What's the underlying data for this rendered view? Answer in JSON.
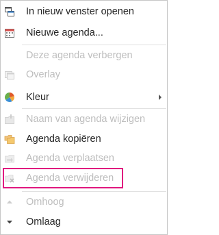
{
  "menu": {
    "items": [
      {
        "label": "In nieuw venster openen",
        "icon": "new-window-icon",
        "enabled": true
      },
      {
        "label": "Nieuwe agenda...",
        "icon": "calendar-icon",
        "enabled": true
      },
      {
        "label": "Deze agenda verbergen",
        "icon": "",
        "enabled": false
      },
      {
        "label": "Overlay",
        "icon": "overlay-icon",
        "enabled": false
      },
      {
        "label": "Kleur",
        "icon": "color-palette-icon",
        "enabled": true,
        "submenu": true
      },
      {
        "label": "Naam van agenda wijzigen",
        "icon": "rename-icon",
        "enabled": false
      },
      {
        "label": "Agenda kopiëren",
        "icon": "copy-folder-icon",
        "enabled": true
      },
      {
        "label": "Agenda verplaatsen",
        "icon": "move-folder-icon",
        "enabled": false
      },
      {
        "label": "Agenda verwijderen",
        "icon": "delete-folder-icon",
        "enabled": false,
        "highlighted": true
      },
      {
        "label": "Omhoog",
        "icon": "up-arrow-icon",
        "enabled": false
      },
      {
        "label": "Omlaag",
        "icon": "down-arrow-icon",
        "enabled": true
      }
    ]
  },
  "colors": {
    "highlight_border": "#e0177f",
    "enabled_text": "#262626",
    "disabled_text": "#bdbdbd"
  }
}
